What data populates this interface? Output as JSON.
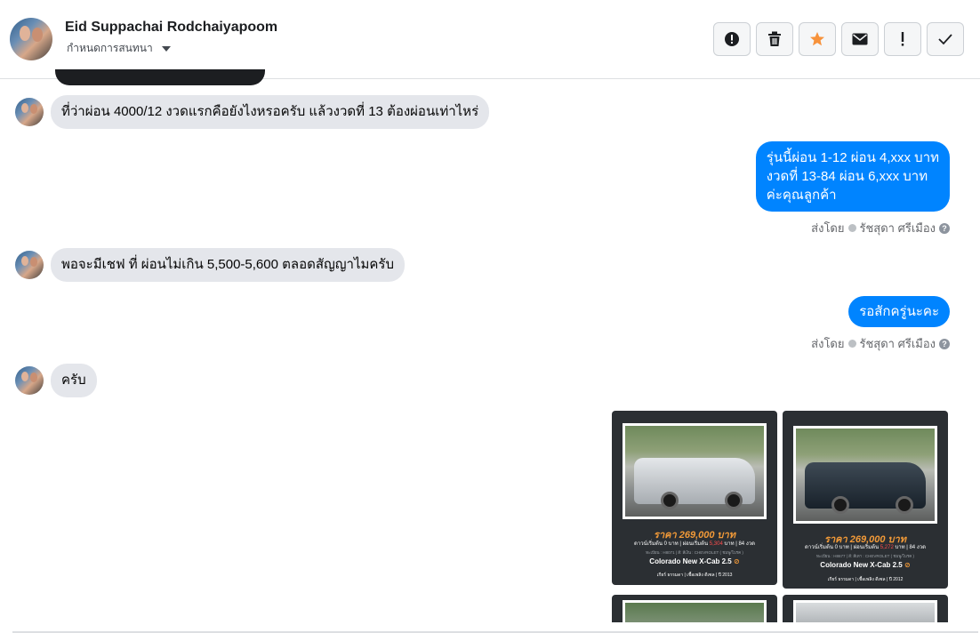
{
  "header": {
    "name": "Eid Suppachai Rodchaiyapoom",
    "subtitle": "กำหนดการสนทนา",
    "icons": [
      "alert-circle-icon",
      "trash-icon",
      "star-icon",
      "envelope-icon",
      "exclamation-icon",
      "check-icon"
    ],
    "accent_star": "#f7923b"
  },
  "messages": [
    {
      "direction": "in",
      "text": "ที่ว่าผ่อน 4000/12 งวดแรกคือยังไงหรอครับ แล้วงวดที่ 13 ต้องผ่อนเท่าไหร่"
    },
    {
      "direction": "out",
      "lines": [
        "รุ่นนี้ผ่อน  1-12  ผ่อน  4,xxx บาท",
        "งวดที่ 13-84  ผ่อน  6,xxx  บาท",
        "ค่ะคุณลูกค้า"
      ],
      "sent_by_label": "ส่งโดย",
      "sender": "รัชสุดา ศรีเมือง"
    },
    {
      "direction": "in",
      "text": "พอจะมีเชฟ ที่ ผ่อนไม่เกิน 5,500-5,600 ตลอดสัญญาไมครับ"
    },
    {
      "direction": "out",
      "lines": [
        "รอสักครู่นะคะ"
      ],
      "sent_by_label": "ส่งโดย",
      "sender": "รัชสุดา ศรีเมือง"
    },
    {
      "direction": "in",
      "text": "ครับ"
    }
  ],
  "cards": [
    {
      "price": "ราคา 269,000 บาท",
      "info_pre": "ดาวน์เริ่มต้น 0 บาท | ผ่อนเริ่มต้น ",
      "monthly": "5,304",
      "info_post": " บาท | 84 งวด",
      "tags": "ทะเบียน : H8071 | สี: สีเงิน : CHEVROLET ( ชมพู/โบรค )",
      "model": "Colorado New X-Cab 2.5",
      "spec": "เกียร์ ธรรมดา  |  เชื้อเพลิง ดีเซล  |  ปี 2013"
    },
    {
      "price": "ราคา 269,000 บาท",
      "info_pre": "ดาวน์เริ่มต้น 0 บาท | ผ่อนเริ่มต้น ",
      "monthly": "5,272",
      "info_post": " บาท | 84 งวด",
      "tags": "ทะเบียน : H8677 | สี: สีเทา : CHEVROLET ( ชมพู/โบรค )",
      "model": "Colorado New X-Cab 2.5",
      "spec": "เกียร์ ธรรมดา  |  เชื้อเพลิง ดีเซล  |  ปี 2012"
    }
  ],
  "colors": {
    "outgoing_bubble": "#0084ff",
    "incoming_bubble": "#e4e6eb",
    "card_bg": "#2b2f33",
    "price": "#f29a38"
  }
}
